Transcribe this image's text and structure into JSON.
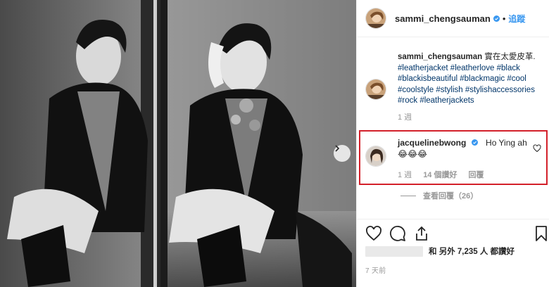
{
  "post": {
    "username": "sammi_chengsauman",
    "follow_label": "追蹤",
    "separator": "•"
  },
  "caption": {
    "username": "sammi_chengsauman",
    "text": "實在太愛皮革.",
    "hashtags": "#leatherjacket #leatherlove #black #blackisbeautiful #blackmagic #cool #coolstyle #stylish #stylishaccessories #rock #leatherjackets",
    "age": "1 週"
  },
  "comment": {
    "username": "jacquelinebwong",
    "text": "Ho Ying ah",
    "emojis": "😂😂😂",
    "age": "1 週",
    "likes": "14 個讚好",
    "reply_label": "回覆",
    "view_replies": "查看回覆（26）"
  },
  "likes_row": {
    "text": "和 另外 7,235 人 都讚好"
  },
  "timestamp": "7 天前",
  "icons": [
    "verified-icon",
    "chevron-right-icon",
    "heart-icon",
    "comment-icon",
    "share-icon",
    "bookmark-icon"
  ],
  "colors": {
    "accent": "#3897f0",
    "highlight": "#d3202a",
    "hashtag": "#003569",
    "muted": "#999999"
  }
}
